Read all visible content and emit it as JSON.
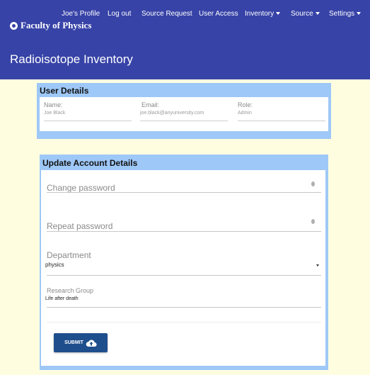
{
  "brand": {
    "name": "Faculty of Physics",
    "icon": "atom-logo-icon"
  },
  "nav": {
    "profile": "Joe's Profile",
    "logout": "Log out",
    "source_request": "Source Request",
    "user_access": "User Access",
    "inventory": "Inventory",
    "source": "Source",
    "settings": "Settings"
  },
  "page": {
    "title": "Radioisotope Inventory"
  },
  "user_details": {
    "title": "User Details",
    "name_label": "Name:",
    "name_value": "Joe Black",
    "email_label": "Email:",
    "email_value": "joe.black@anyuniversity.com",
    "role_label": "Role:",
    "role_value": "Admin"
  },
  "update_form": {
    "title": "Update Account Details",
    "change_password_placeholder": "Change password",
    "repeat_password_placeholder": "Repeat password",
    "department_label": "Department",
    "department_value": "physics",
    "research_group_label": "Research Group",
    "research_group_value": "Life after death",
    "submit_label": "SUBMIT"
  },
  "colors": {
    "header_bg": "#3743a7",
    "page_bg": "#fffde0",
    "card_header_bg": "#9ec8f7",
    "submit_bg": "#1f4e8c"
  }
}
